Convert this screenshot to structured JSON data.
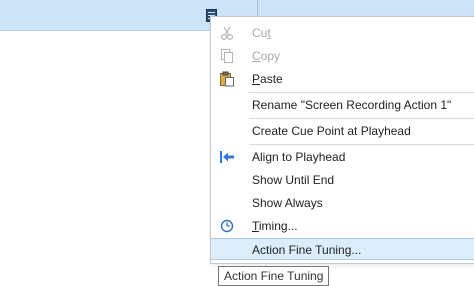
{
  "menu": {
    "cut": {
      "pre": "Cu",
      "key": "t",
      "post": ""
    },
    "copy": {
      "pre": "",
      "key": "C",
      "post": "opy"
    },
    "paste": {
      "pre": "",
      "key": "P",
      "post": "aste"
    },
    "rename": "Rename \"Screen Recording Action 1\"",
    "create_cue_point": "Create Cue Point at Playhead",
    "align_to_playhead": "Align to Playhead",
    "show_until_end": "Show Until End",
    "show_always": "Show Always",
    "timing": {
      "pre": "",
      "key": "T",
      "post": "iming..."
    },
    "action_fine_tuning": "Action Fine Tuning..."
  },
  "tooltip": {
    "text": "Action Fine Tuning"
  },
  "icons": {
    "cut": "scissors-icon",
    "copy": "copy-icon",
    "paste": "clipboard-icon",
    "align": "align-arrow-icon",
    "timing": "clock-icon",
    "action_marker": "action-marker-icon"
  },
  "colors": {
    "selection_bar": "#cde3f6",
    "menu_highlight": "#dceefb",
    "highlight_border": "#a6cdee",
    "disabled_text": "#a8a8a8",
    "align_icon": "#2f7ad8"
  }
}
